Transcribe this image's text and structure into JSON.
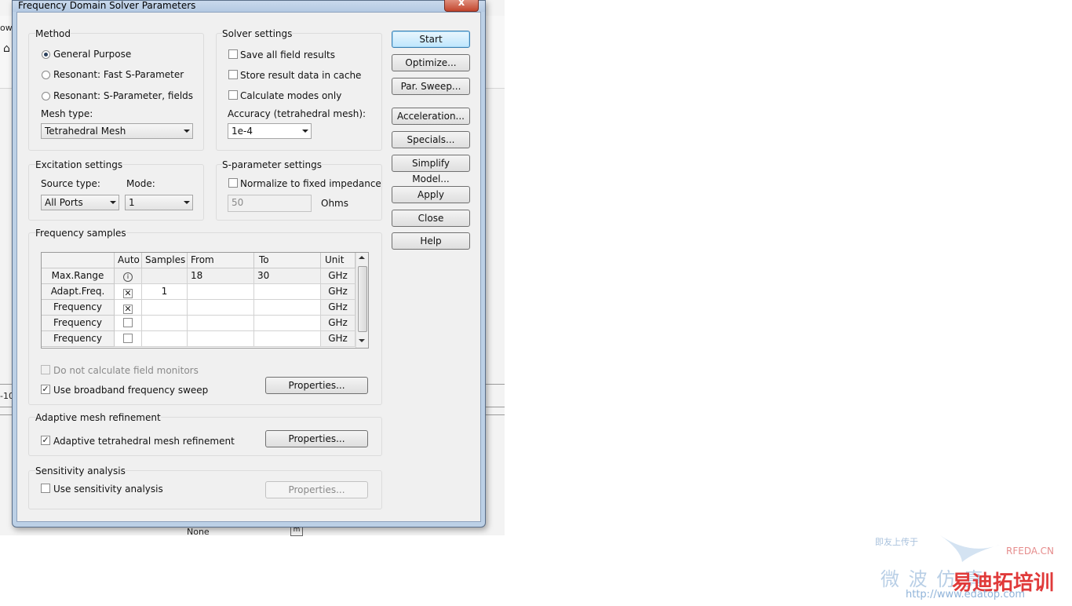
{
  "background": {
    "left_fragment_1": "ow",
    "left_fragment_2": "-10",
    "bottom_cell": "None"
  },
  "dialog": {
    "title": "Frequency Domain Solver Parameters",
    "close_glyph": "x"
  },
  "method": {
    "label": "Method",
    "options": [
      "General Purpose",
      "Resonant: Fast S-Parameter",
      "Resonant: S-Parameter, fields"
    ],
    "selected": 0,
    "mesh_type_label": "Mesh type:",
    "mesh_type_value": "Tetrahedral Mesh"
  },
  "solver": {
    "label": "Solver settings",
    "save_all_fields": "Save all field results",
    "store_cache": "Store result data in cache",
    "calc_modes": "Calculate modes only",
    "accuracy_label": "Accuracy (tetrahedral mesh):",
    "accuracy_value": "1e-4"
  },
  "excitation": {
    "label": "Excitation settings",
    "source_type_label": "Source type:",
    "source_type_value": "All Ports",
    "mode_label": "Mode:",
    "mode_value": "1"
  },
  "sparam": {
    "label": "S-parameter settings",
    "normalize": "Normalize to fixed impedance",
    "impedance_value": "50",
    "unit": "Ohms"
  },
  "freq": {
    "label": "Frequency samples",
    "columns": [
      "Auto",
      "Samples",
      "From",
      "To",
      "Unit"
    ],
    "rows": [
      {
        "name": "Max.Range",
        "auto": "info",
        "samples": "",
        "from": "18",
        "to": "30",
        "unit": "GHz"
      },
      {
        "name": "Adapt.Freq.",
        "auto": "checked",
        "samples": "1",
        "from": "",
        "to": "",
        "unit": "GHz"
      },
      {
        "name": "Frequency",
        "auto": "checked",
        "samples": "",
        "from": "",
        "to": "",
        "unit": "GHz"
      },
      {
        "name": "Frequency",
        "auto": "unchecked",
        "samples": "",
        "from": "",
        "to": "",
        "unit": "GHz"
      },
      {
        "name": "Frequency",
        "auto": "unchecked",
        "samples": "",
        "from": "",
        "to": "",
        "unit": "GHz"
      }
    ],
    "no_field_monitors": "Do not calculate field monitors",
    "broadband": "Use broadband frequency sweep",
    "properties": "Properties..."
  },
  "adaptive": {
    "label": "Adaptive mesh refinement",
    "checkbox": "Adaptive tetrahedral mesh refinement",
    "properties": "Properties..."
  },
  "sensitivity": {
    "label": "Sensitivity analysis",
    "checkbox": "Use sensitivity analysis",
    "properties": "Properties..."
  },
  "buttons": {
    "start": "Start",
    "optimize": "Optimize...",
    "par_sweep": "Par. Sweep...",
    "acceleration": "Acceleration...",
    "specials": "Specials...",
    "simplify": "Simplify Model...",
    "apply": "Apply",
    "close": "Close",
    "help": "Help"
  },
  "watermark": {
    "small_cn": "即友上传于",
    "rfeda": "RFEDA.CN",
    "big_cn_left": "微 波 仿 真",
    "big_cn_right": "易迪拓培训",
    "url": "http://www.edatop.com"
  },
  "colors": {
    "accent_default_button": "#bee6fd",
    "watermark_red": "#e03a3a",
    "watermark_blue": "#8fb3d9"
  }
}
